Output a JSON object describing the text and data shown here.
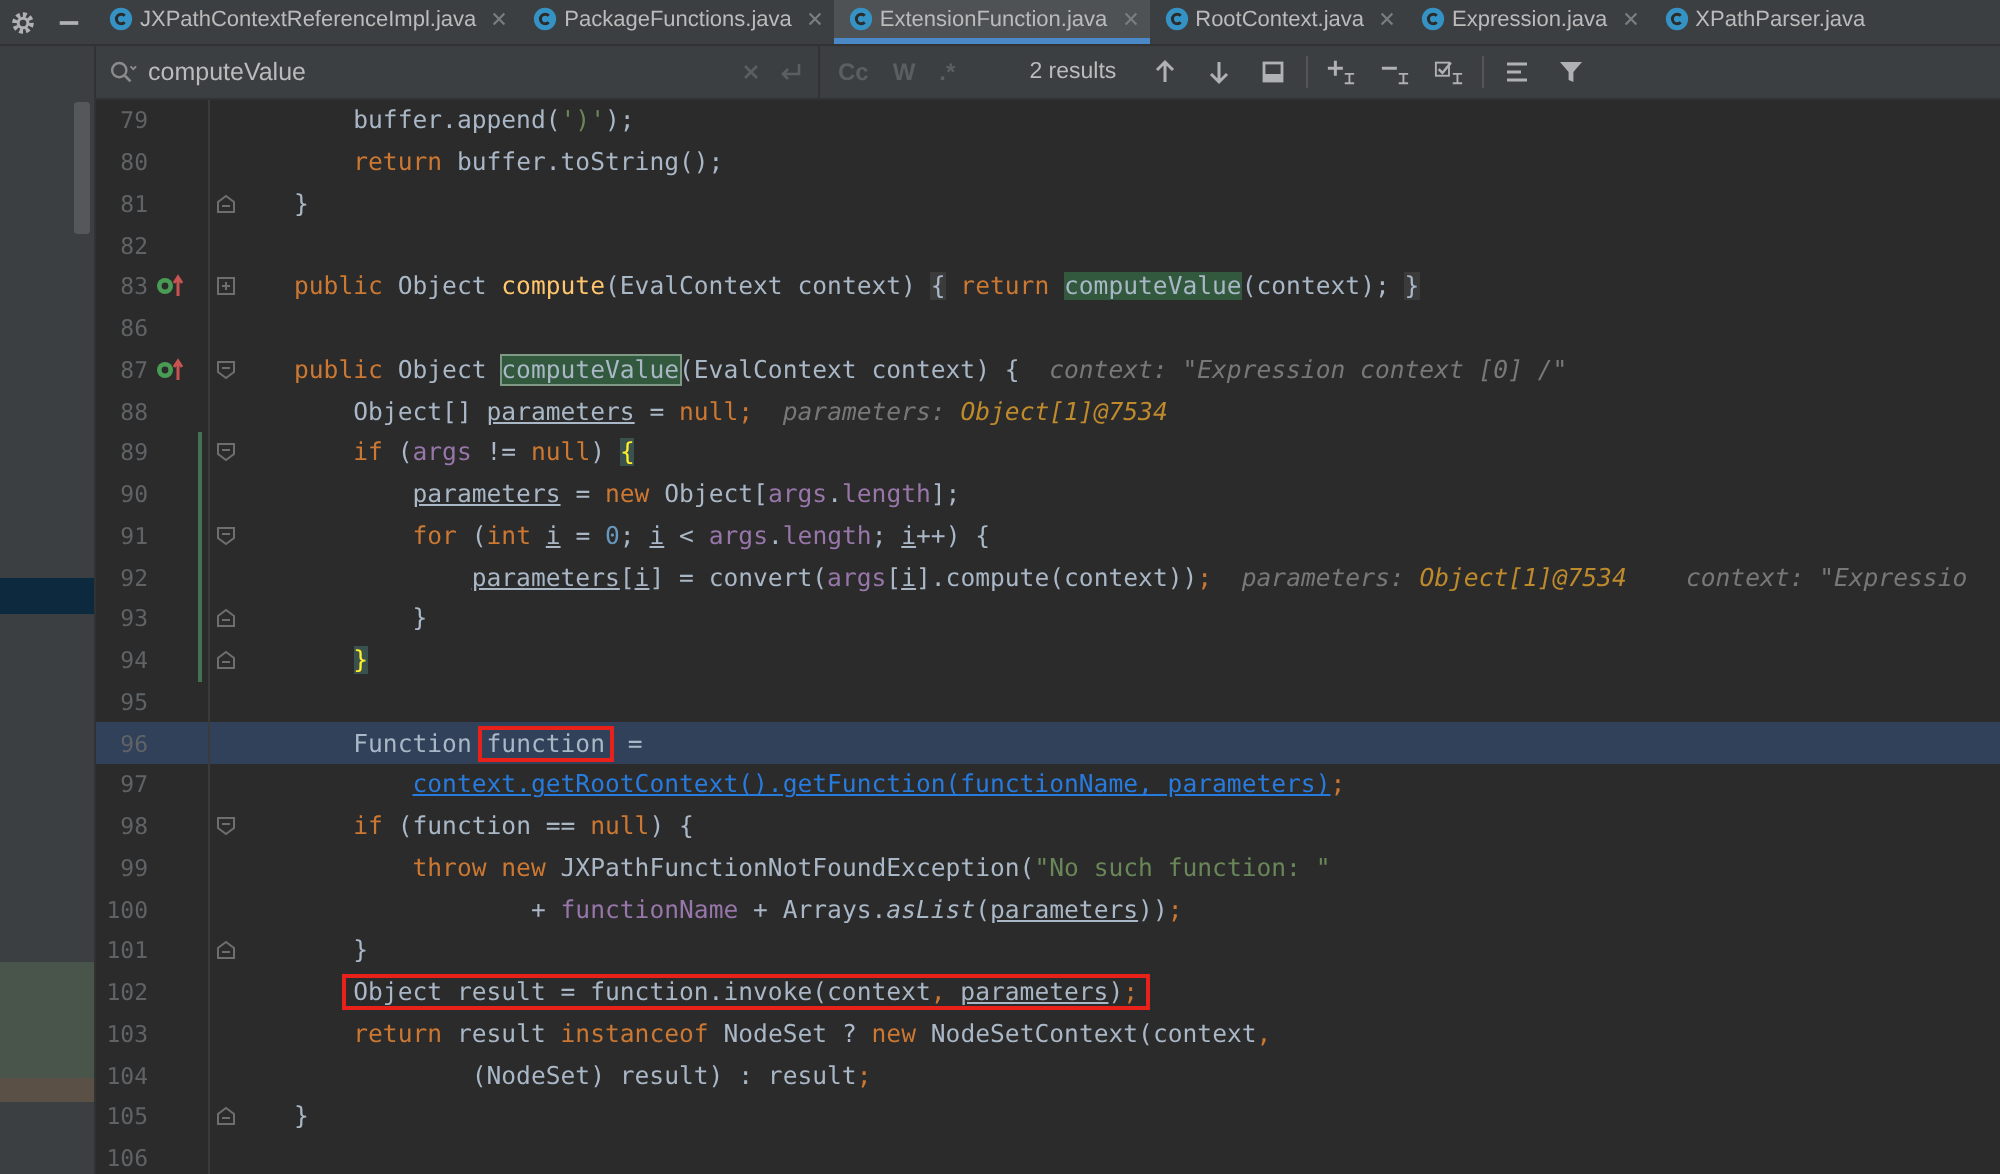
{
  "tabs": [
    {
      "label": "JXPathContextReferenceImpl.java",
      "selected": false
    },
    {
      "label": "PackageFunctions.java",
      "selected": false
    },
    {
      "label": "ExtensionFunction.java",
      "selected": true
    },
    {
      "label": "RootContext.java",
      "selected": false
    },
    {
      "label": "Expression.java",
      "selected": false
    },
    {
      "label": "XPathParser.java",
      "selected": false
    }
  ],
  "search": {
    "value": "computeValue",
    "options": [
      {
        "label": "Cc"
      },
      {
        "label": "W"
      },
      {
        "label": ".*"
      }
    ],
    "results": "2 results"
  },
  "lines": [
    {
      "number": "79",
      "current": false,
      "boxed": false,
      "changed": false,
      "tokens": [
        {
          "kind": "plain",
          "text": "    buffer.append("
        },
        {
          "kind": "string",
          "text": "')'"
        },
        {
          "kind": "plain",
          "text": ");"
        }
      ]
    },
    {
      "number": "80",
      "current": false,
      "boxed": false,
      "changed": false,
      "tokens": [
        {
          "kind": "kw",
          "text": "    return"
        },
        {
          "kind": "plain",
          "text": " buffer.toString();"
        }
      ]
    },
    {
      "number": "81",
      "current": false,
      "boxed": false,
      "changed": false,
      "gutter_icons": [
        {
          "kind": "fold-end"
        }
      ],
      "tokens": [
        {
          "kind": "plain",
          "text": "}"
        }
      ]
    },
    {
      "number": "82",
      "current": false,
      "boxed": false,
      "changed": false
    },
    {
      "number": "83",
      "current": false,
      "boxed": false,
      "changed": false,
      "gutter_icons": [
        {
          "kind": "override"
        },
        {
          "kind": "fold-collapsed"
        }
      ],
      "tokens": [
        {
          "kind": "kw",
          "text": "public"
        },
        {
          "kind": "plain",
          "text": " Object "
        },
        {
          "kind": "method",
          "text": "compute"
        },
        {
          "kind": "plain",
          "text": "(EvalContext context) "
        },
        {
          "kind": "fold",
          "text": "{"
        },
        {
          "kind": "kw",
          "text": " return"
        },
        {
          "kind": "match",
          "text": " computeValue"
        },
        {
          "kind": "plain",
          "text": "(context); "
        },
        {
          "kind": "fold",
          "text": "}"
        }
      ]
    },
    {
      "number": "86",
      "current": false,
      "boxed": false,
      "changed": false
    },
    {
      "number": "87",
      "current": false,
      "boxed": false,
      "changed": false,
      "gutter_icons": [
        {
          "kind": "override"
        },
        {
          "kind": "fold-start"
        }
      ],
      "tokens": [
        {
          "kind": "kw",
          "text": "public"
        },
        {
          "kind": "plain",
          "text": " Object "
        },
        {
          "kind": "match-current",
          "text": "computeValue"
        },
        {
          "kind": "plain",
          "text": "(EvalContext context) {"
        },
        {
          "kind": "hint",
          "text": "context: \"Expression context [0] /\""
        }
      ]
    },
    {
      "number": "88",
      "current": false,
      "boxed": false,
      "changed": false,
      "tokens": [
        {
          "kind": "plain",
          "text": "    Object[] "
        },
        {
          "kind": "under",
          "text": "parameters"
        },
        {
          "kind": "plain",
          "text": " = "
        },
        {
          "kind": "kw",
          "text": "null;"
        },
        {
          "kind": "hint",
          "text": "parameters: "
        },
        {
          "kind": "hint-value",
          "text": "Object[1]@7534"
        }
      ]
    },
    {
      "number": "89",
      "current": false,
      "boxed": false,
      "changed": true,
      "gutter_icons": [
        {
          "kind": "fold-start"
        }
      ],
      "tokens": [
        {
          "kind": "kw",
          "text": "    if"
        },
        {
          "kind": "plain",
          "text": " ("
        },
        {
          "kind": "field",
          "text": "args"
        },
        {
          "kind": "plain",
          "text": " != "
        },
        {
          "kind": "kw",
          "text": "null"
        },
        {
          "kind": "plain",
          "text": ") "
        },
        {
          "kind": "brace",
          "text": "{"
        }
      ]
    },
    {
      "number": "90",
      "current": false,
      "boxed": false,
      "changed": true,
      "tokens": [
        {
          "kind": "under",
          "text": "        parameters"
        },
        {
          "kind": "plain",
          "text": " = "
        },
        {
          "kind": "kw",
          "text": "new"
        },
        {
          "kind": "plain",
          "text": " Object["
        },
        {
          "kind": "field",
          "text": "args"
        },
        {
          "kind": "plain",
          "text": "."
        },
        {
          "kind": "field",
          "text": "length"
        },
        {
          "kind": "plain",
          "text": "];"
        }
      ]
    },
    {
      "number": "91",
      "current": false,
      "boxed": false,
      "changed": true,
      "gutter_icons": [
        {
          "kind": "fold-start"
        }
      ],
      "tokens": [
        {
          "kind": "kw",
          "text": "        for"
        },
        {
          "kind": "plain",
          "text": " ("
        },
        {
          "kind": "kw",
          "text": "int"
        },
        {
          "kind": "under",
          "text": " i"
        },
        {
          "kind": "plain",
          "text": " = "
        },
        {
          "kind": "num",
          "text": "0"
        },
        {
          "kind": "plain",
          "text": ";"
        },
        {
          "kind": "under",
          "text": " i"
        },
        {
          "kind": "plain",
          "text": " < "
        },
        {
          "kind": "field",
          "text": "args"
        },
        {
          "kind": "plain",
          "text": "."
        },
        {
          "kind": "field",
          "text": "length"
        },
        {
          "kind": "plain",
          "text": ";"
        },
        {
          "kind": "under",
          "text": " i"
        },
        {
          "kind": "plain",
          "text": "++) {"
        }
      ]
    },
    {
      "number": "92",
      "current": false,
      "boxed": false,
      "changed": true,
      "tokens": [
        {
          "kind": "under",
          "text": "            parameters"
        },
        {
          "kind": "plain",
          "text": "["
        },
        {
          "kind": "under",
          "text": "i"
        },
        {
          "kind": "plain",
          "text": "] = convert("
        },
        {
          "kind": "field",
          "text": "args"
        },
        {
          "kind": "plain",
          "text": "["
        },
        {
          "kind": "under",
          "text": "i"
        },
        {
          "kind": "plain",
          "text": "].compute(context))"
        },
        {
          "kind": "kw",
          "text": ";"
        },
        {
          "kind": "hint",
          "text": "parameters: "
        },
        {
          "kind": "hint-value",
          "text": "Object[1]@7534"
        },
        {
          "kind": "hint-far",
          "text": "context: \"Expressio"
        }
      ]
    },
    {
      "number": "93",
      "current": false,
      "boxed": false,
      "changed": true,
      "gutter_icons": [
        {
          "kind": "fold-end"
        }
      ],
      "tokens": [
        {
          "kind": "plain",
          "text": "        }"
        }
      ]
    },
    {
      "number": "94",
      "current": false,
      "boxed": false,
      "changed": true,
      "gutter_icons": [
        {
          "kind": "fold-end"
        }
      ],
      "tokens": [
        {
          "kind": "brace",
          "text": "    }"
        }
      ]
    },
    {
      "number": "95",
      "current": false,
      "boxed": false,
      "changed": false
    },
    {
      "number": "96",
      "current": true,
      "boxed": false,
      "changed": false,
      "tokens": [
        {
          "kind": "plain",
          "text": "    Function "
        },
        {
          "kind": "boxed",
          "text": "function"
        },
        {
          "kind": "plain",
          "text": " ="
        }
      ]
    },
    {
      "number": "97",
      "current": false,
      "boxed": false,
      "changed": false,
      "tokens": [
        {
          "kind": "link",
          "text": "        context.getRootContext().getFunction(functionName, parameters)"
        },
        {
          "kind": "kw",
          "text": ";"
        }
      ]
    },
    {
      "number": "98",
      "current": false,
      "boxed": false,
      "changed": false,
      "gutter_icons": [
        {
          "kind": "fold-start"
        }
      ],
      "tokens": [
        {
          "kind": "kw",
          "text": "    if"
        },
        {
          "kind": "plain",
          "text": " (function == "
        },
        {
          "kind": "kw",
          "text": "null"
        },
        {
          "kind": "plain",
          "text": ") {"
        }
      ]
    },
    {
      "number": "99",
      "current": false,
      "boxed": false,
      "changed": false,
      "tokens": [
        {
          "kind": "kw",
          "text": "        throw new"
        },
        {
          "kind": "plain",
          "text": " JXPathFunctionNotFoundException("
        },
        {
          "kind": "string",
          "text": "\"No such function: \""
        }
      ]
    },
    {
      "number": "100",
      "current": false,
      "boxed": false,
      "changed": false,
      "tokens": [
        {
          "kind": "plain",
          "text": "                + "
        },
        {
          "kind": "field",
          "text": "functionName"
        },
        {
          "kind": "plain",
          "text": " + Arrays."
        },
        {
          "kind": "italic",
          "text": "asList"
        },
        {
          "kind": "plain",
          "text": "("
        },
        {
          "kind": "under",
          "text": "parameters"
        },
        {
          "kind": "plain",
          "text": "))"
        },
        {
          "kind": "kw",
          "text": ";"
        }
      ]
    },
    {
      "number": "101",
      "current": false,
      "boxed": false,
      "changed": false,
      "gutter_icons": [
        {
          "kind": "fold-end"
        }
      ],
      "tokens": [
        {
          "kind": "plain",
          "text": "    }"
        }
      ]
    },
    {
      "number": "102",
      "current": false,
      "boxed": true,
      "changed": false,
      "tokens": [
        {
          "kind": "plain",
          "text": "    Object result = function.invoke(context"
        },
        {
          "kind": "kw",
          "text": ","
        },
        {
          "kind": "under",
          "text": " parameters"
        },
        {
          "kind": "plain",
          "text": ")"
        },
        {
          "kind": "kw",
          "text": ";"
        }
      ]
    },
    {
      "number": "103",
      "current": false,
      "boxed": false,
      "changed": false,
      "tokens": [
        {
          "kind": "kw",
          "text": "    return"
        },
        {
          "kind": "plain",
          "text": " result "
        },
        {
          "kind": "kw",
          "text": "instanceof"
        },
        {
          "kind": "plain",
          "text": " NodeSet ? "
        },
        {
          "kind": "kw",
          "text": "new"
        },
        {
          "kind": "plain",
          "text": " NodeSetContext(context"
        },
        {
          "kind": "kw",
          "text": ","
        }
      ]
    },
    {
      "number": "104",
      "current": false,
      "boxed": false,
      "changed": false,
      "tokens": [
        {
          "kind": "plain",
          "text": "            (NodeSet) result) : result"
        },
        {
          "kind": "kw",
          "text": ";"
        }
      ]
    },
    {
      "number": "105",
      "current": false,
      "boxed": false,
      "changed": false,
      "gutter_icons": [
        {
          "kind": "fold-end"
        }
      ],
      "tokens": [
        {
          "kind": "plain",
          "text": "}"
        }
      ]
    },
    {
      "number": "106",
      "current": false,
      "boxed": false,
      "changed": false
    }
  ]
}
